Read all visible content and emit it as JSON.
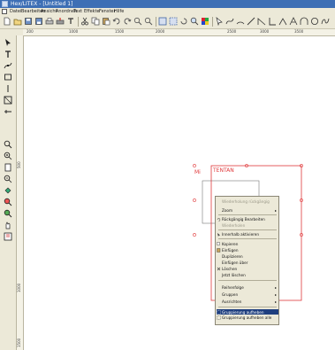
{
  "window": {
    "title": "Hex/LITEX - [Untitled 1]"
  },
  "menubar": {
    "items": [
      "Datei",
      "Bearbeiten",
      "Ansicht",
      "Anordnen",
      "Text",
      "Effekte",
      "Fenster",
      "Hilfe"
    ]
  },
  "ruler_h": {
    "labels": [
      "200",
      "1000",
      "1500",
      "2000",
      "2500",
      "3000",
      "3500"
    ]
  },
  "ruler_v": {
    "labels": [
      "500",
      "1000",
      "1500"
    ]
  },
  "canvas": {
    "red_label": "Mi",
    "red_text": "TENTAN"
  },
  "context_menu": {
    "items": [
      {
        "label": "Wiederholung rückgängig",
        "disabled": true
      },
      {
        "label": "Zoom",
        "submenu": true
      },
      {
        "label": "Rückgängig Bearbeiten"
      },
      {
        "label": "Wiederholen",
        "disabled": true
      },
      {
        "label": "Innerhalb aktivieren"
      },
      {
        "label": "Kopieren"
      },
      {
        "label": "Einfügen"
      },
      {
        "label": "Duplizieren"
      },
      {
        "label": "Einfügen über"
      },
      {
        "label": "Löschen"
      },
      {
        "label": "Jetzt löschen"
      },
      {
        "label": "Reihenfolge",
        "submenu": true
      },
      {
        "label": "Gruppen",
        "submenu": true
      },
      {
        "label": "Ausrichten",
        "submenu": true
      },
      {
        "label": "Gruppierung aufheben",
        "selected": true
      },
      {
        "label": "Gruppierung aufheben alle"
      }
    ]
  },
  "colors": {
    "titlebar": "#3d6fb5",
    "selection": "#e0383a",
    "menu_bg": "#ece9d8",
    "highlight": "#1f3f7f"
  }
}
